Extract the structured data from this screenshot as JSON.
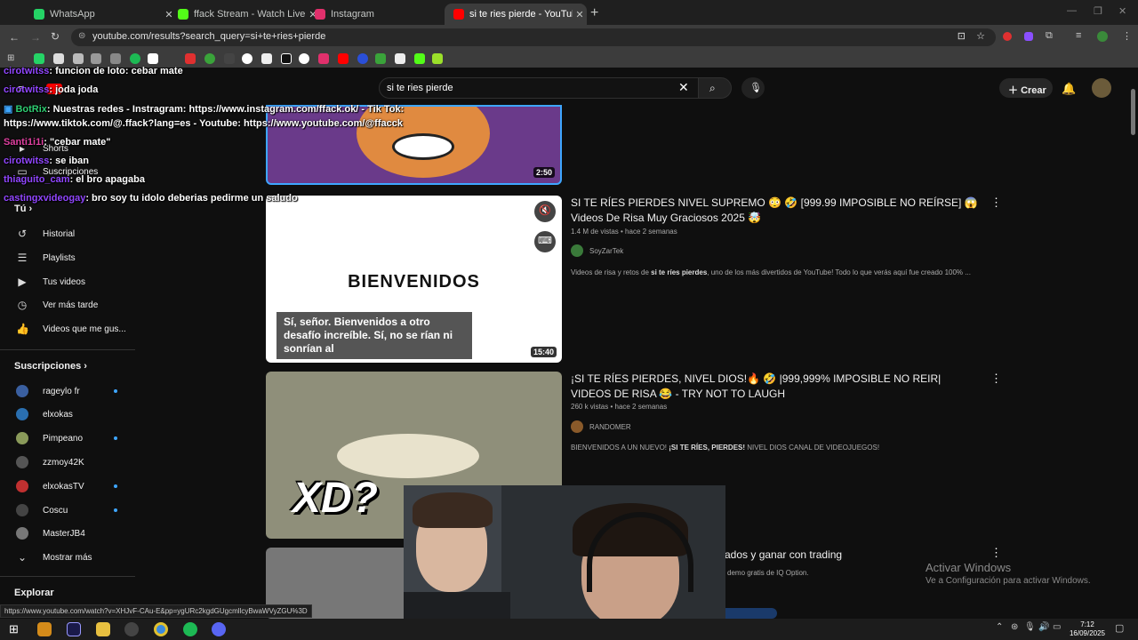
{
  "browser": {
    "tabs": [
      {
        "title": "WhatsApp",
        "color": "#25d366"
      },
      {
        "title": "ffack Stream - Watch Live on K",
        "color": "#53fc18"
      },
      {
        "title": "Instagram",
        "color": "#e1306c"
      },
      {
        "title": "si te ries pierde - YouTube",
        "color": "#ff0000"
      }
    ],
    "url": "youtube.com/results?search_query=si+te+ries+pierde",
    "status_url": "https://www.youtube.com/watch?v=XHJvF-CAu-E&pp=ygURc2kgdGUgcmllcyBwaWVyZGU%3D"
  },
  "youtube": {
    "search_value": "si te ries pierde",
    "create_label": "Crear",
    "sidebar": {
      "you_label": "Tú",
      "shorts": "Shorts",
      "subscriptions_top": "Suscripciones",
      "you_items": [
        "Historial",
        "Playlists",
        "Tus videos",
        "Ver más tarde",
        "Videos que me gus..."
      ],
      "subs_title": "Suscripciones",
      "subs": [
        "rageylo fr",
        "elxokas",
        "Pimpeano",
        "zzmoy42K",
        "elxokasTV",
        "Coscu",
        "MasterJB4"
      ],
      "show_more": "Mostrar más",
      "explore": "Explorar"
    },
    "results": [
      {
        "duration": "2:50"
      },
      {
        "title": "SI TE RÍES PIERDES NIVEL SUPREMO 😳 🤣 [999.99 IMPOSIBLE NO REÍRSE] 😱 Videos De Risa Muy Graciosos 2025 🤯",
        "meta": "1.4 M de vistas • hace 2 semanas",
        "channel": "SoyZarTek",
        "desc_pre": "Videos de risa y retos de ",
        "desc_bold": "si te ríes pierdes",
        "desc_post": ", uno de los más divertidos de YouTube! Todo lo que verás aquí fue creado 100% ...",
        "thumb_text": "BIENVENIDOS",
        "caption": "Sí, señor. Bienvenidos a otro desafío increíble. Sí, no se rían ni sonrían al",
        "duration": "15:40"
      },
      {
        "title": "¡SI TE RÍES PIERDES, NIVEL DIOS!🔥 🤣 |999,999% IMPOSIBLE NO REIR| VIDEOS DE RISA 😂 - TRY NOT TO LAUGH",
        "meta": "260 k vistas • hace 2 semanas",
        "channel": "RANDOMER",
        "desc_pre": "BIENVENIDOS A UN NUEVO! ",
        "desc_bold": "¡SI TE RÍES, PIERDES!",
        "desc_post": " NIVEL DIOS CANAL DE VIDEOJUEGOS!",
        "thumb_text": "XD?"
      },
      {
        "title_partial": "ados y ganar con trading",
        "desc_partial": "demo gratis de IQ Option."
      }
    ]
  },
  "chat": [
    {
      "user": "cirotwitss",
      "msg": ": funcion de loto: cebar mate"
    },
    {
      "user": "cirotwitss",
      "msg": ": joda joda"
    },
    {
      "user": "BotRix",
      "msg": ": Nuestras redes - Instragram: https://www.instagram.com/ffack.ok/ - Tik Tok:"
    },
    {
      "user": "",
      "msg": "https://www.tiktok.com/@.ffack?lang=es - Youtube: https://www.youtube.com/@ffacck"
    },
    {
      "user": "Santi1i1i",
      "msg": ": \"cebar mate\""
    },
    {
      "user": "cirotwitss",
      "msg": ": se iban"
    },
    {
      "user": "thiaguito_cam",
      "msg": ": el bro apagaba"
    },
    {
      "user": "castingxvideogay",
      "msg": ": bro soy tu idolo deberias pedirme un saludo"
    }
  ],
  "windows": {
    "watermark_title": "Activar Windows",
    "watermark_sub": "Ve a Configuración para activar Windows.",
    "time": "7:12",
    "date": "16/09/2025"
  }
}
